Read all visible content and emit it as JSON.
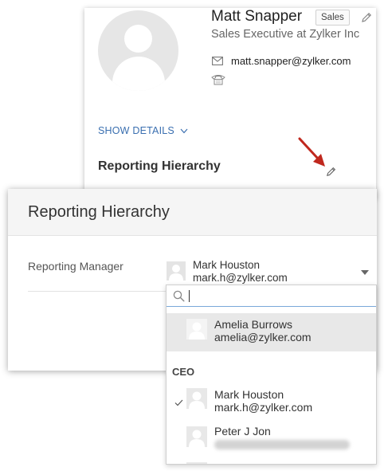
{
  "profile": {
    "name": "Matt Snapper",
    "tag": "Sales",
    "title": "Sales Executive at Zylker Inc",
    "email": "matt.snapper@zylker.com",
    "show_details": "SHOW DETAILS",
    "section_heading": "Reporting Hierarchy"
  },
  "dialog": {
    "title": "Reporting Hierarchy",
    "field_label": "Reporting Manager",
    "selected_name": "Mark Houston",
    "selected_email": "mark.h@zylker.com"
  },
  "dropdown": {
    "search_value": "",
    "options": [
      {
        "name": "Amelia Burrows",
        "email": "amelia@zylker.com",
        "highlighted": true
      }
    ],
    "group_label": "CEO",
    "group_options": [
      {
        "name": "Mark Houston",
        "email": "mark.h@zylker.com",
        "selected": true
      },
      {
        "name": "Peter J Jon",
        "email_obscured": true
      }
    ]
  },
  "colors": {
    "link_blue": "#3a6fb0",
    "annotation_arrow": "#c0281e",
    "highlight_row": "#e8e8e8",
    "search_focus_border": "#79a8d9"
  },
  "icons": [
    "pencil-icon",
    "mail-icon",
    "phone-icon",
    "chevron-down-icon",
    "search-icon",
    "checkmark-icon",
    "avatar-placeholder-icon",
    "annotation-arrow"
  ]
}
